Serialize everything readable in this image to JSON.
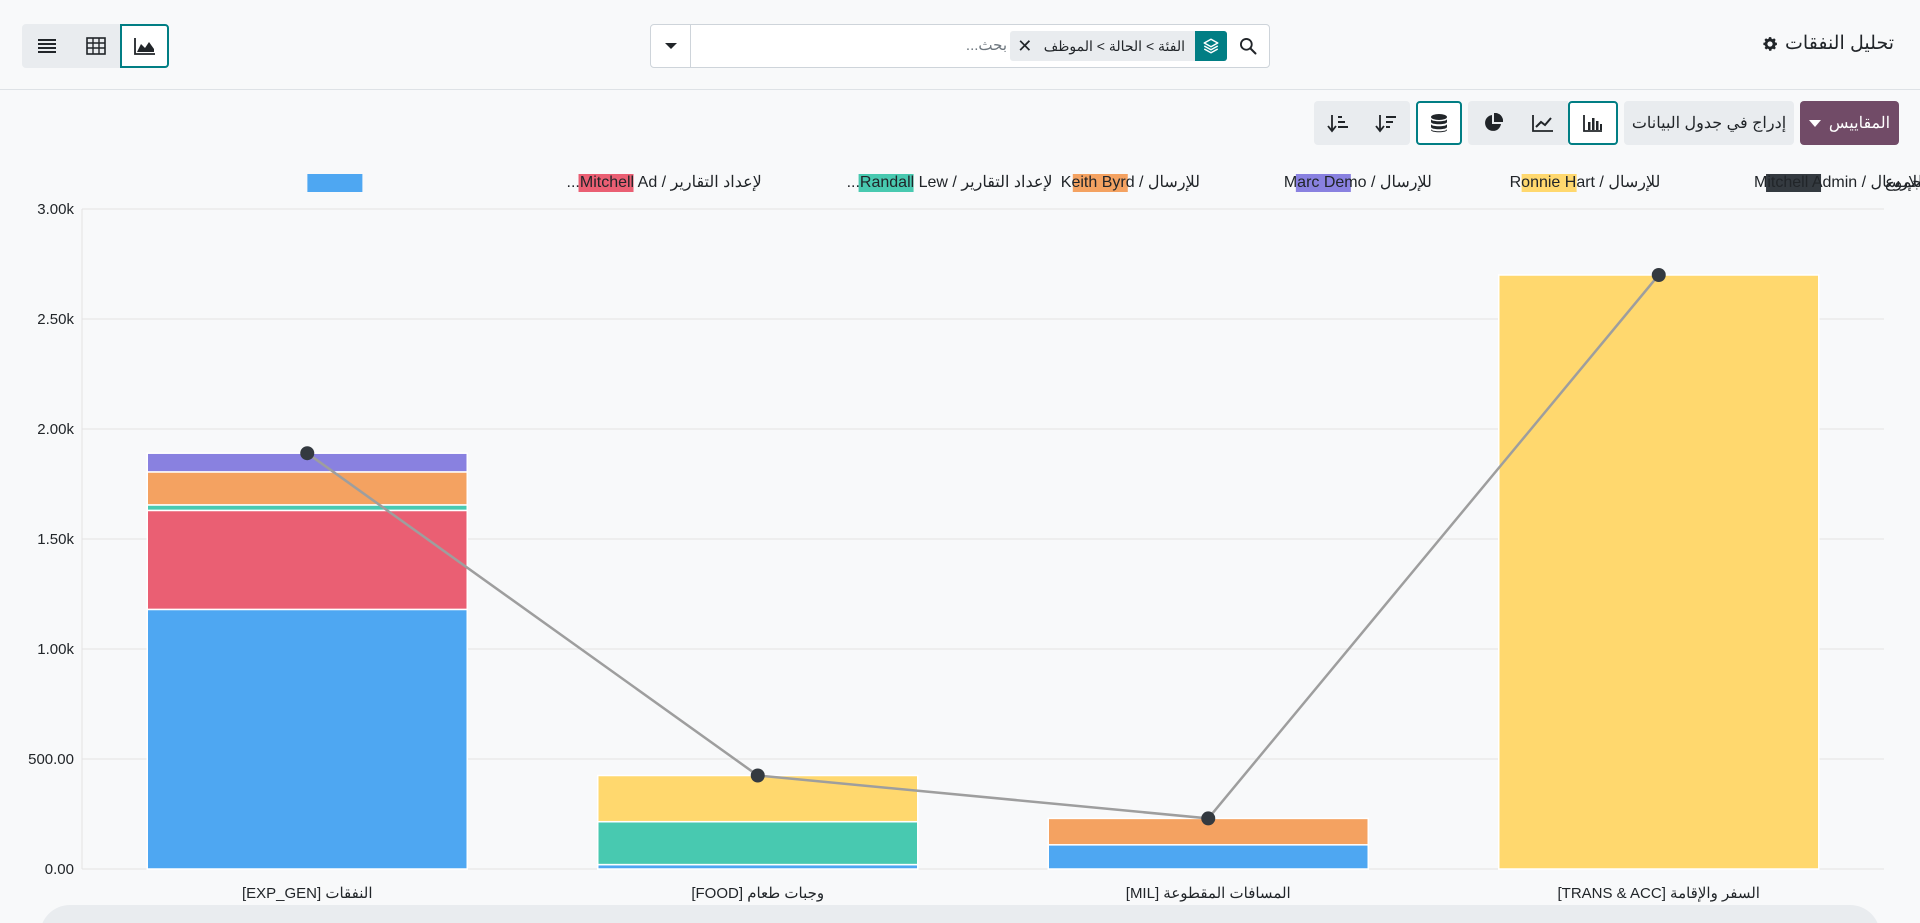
{
  "header": {
    "title": "تحليل النفقات",
    "search": {
      "placeholder": "بحث...",
      "facet": "الفئة > الحالة > الموظف"
    },
    "views": [
      {
        "name": "list",
        "icon": "list-icon"
      },
      {
        "name": "pivot",
        "icon": "pivot-table-icon"
      },
      {
        "name": "graph",
        "icon": "area-chart-icon",
        "active": true
      }
    ]
  },
  "toolbar": {
    "measures_label": "المقاييس",
    "insert_label": "إدراج في جدول البيانات",
    "chart_type_buttons": [
      {
        "name": "bar",
        "icon": "bar-chart-icon",
        "active": true
      },
      {
        "name": "line",
        "icon": "line-chart-icon"
      },
      {
        "name": "pie",
        "icon": "pie-chart-icon"
      },
      {
        "name": "stacked",
        "icon": "database-stack-icon",
        "active": true
      },
      {
        "name": "descending",
        "icon": "sort-descending-icon"
      },
      {
        "name": "ascending",
        "icon": "sort-ascending-icon"
      }
    ]
  },
  "colors": {
    "brand": "#714b67",
    "accent": "#017e84"
  },
  "chart_data": {
    "type": "bar",
    "stacked": true,
    "categories": [
      "النفقات [EXP_GEN]",
      "وجبات طعام [FOOD]",
      "المسافات المقطوعة [MIL]",
      "السفر والإقامة [TRANS & ACC]"
    ],
    "series": [
      {
        "name": "المجموع",
        "type": "line",
        "color": "#343a40",
        "values": [
          1890,
          425,
          230,
          2700
        ]
      },
      {
        "name": "للإرسال / Mitchell Admin",
        "color": "#ffd86e",
        "values": [
          0,
          210,
          0,
          2700
        ]
      },
      {
        "name": "للإرسال / Ronnie Hart",
        "color": "#8981e0",
        "values": [
          85,
          0,
          0,
          0
        ]
      },
      {
        "name": "للإرسال / Marc Demo",
        "color": "#f4a261",
        "values": [
          150,
          0,
          120,
          0
        ]
      },
      {
        "name": "للإرسال / Keith Byrd",
        "color": "#48c9b0",
        "values": [
          25,
          195,
          0,
          0
        ]
      },
      {
        "name": "لإعداد التقارير / Randall Lew...",
        "color": "#ea5f73",
        "values": [
          450,
          0,
          0,
          0
        ]
      },
      {
        "name": "لإعداد التقارير / Mitchell Ad...",
        "color": "#4ea7f2",
        "values": [
          1180,
          20,
          110,
          0
        ]
      }
    ],
    "yticks": [
      "0.00",
      "500.00",
      "1.00k",
      "1.50k",
      "2.00k",
      "2.50k",
      "3.00k"
    ],
    "ylim": [
      0,
      3000
    ],
    "grid": true,
    "legend_position": "top"
  }
}
